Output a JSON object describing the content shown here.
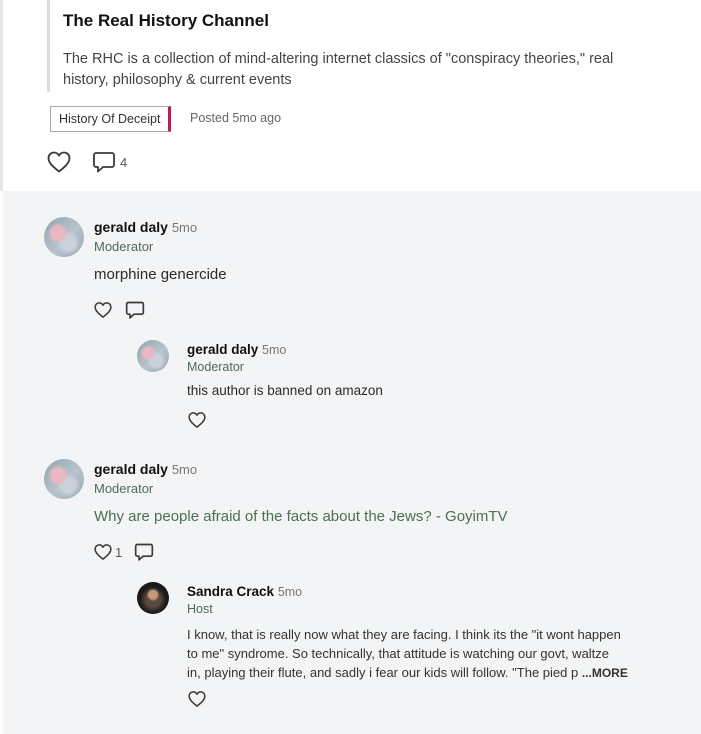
{
  "post": {
    "title": "The Real History Channel",
    "description": "The RHC is a collection of mind-altering internet classics of \"conspiracy theories,\" real history, philosophy & current events",
    "tag": "History Of Deceipt",
    "posted": "Posted 5mo ago",
    "comment_count": "4"
  },
  "comments": [
    {
      "author": "gerald daly",
      "time": "5mo",
      "role": "Moderator",
      "text": "morphine genercide",
      "likes": "",
      "replies": [
        {
          "author": "gerald daly",
          "time": "5mo",
          "role": "Moderator",
          "text": "this author is banned on amazon"
        }
      ]
    },
    {
      "author": "gerald daly",
      "time": "5mo",
      "role": "Moderator",
      "text": "Why are people afraid of the facts about the Jews? - GoyimTV",
      "likes": "1",
      "replies": [
        {
          "author": "Sandra Crack",
          "time": "5mo",
          "role": "Host",
          "text_line1": "I know, that is really now what they are facing. I think its the \"it wont happen",
          "text_line2": "to me\" syndrome. So technically, that attitude is watching our govt, waltze",
          "text_line3": "in, playing their flute, and sadly i fear our kids will follow. \"The pied p",
          "more": "...MORE"
        }
      ]
    }
  ],
  "icons": {
    "like": "heart-icon",
    "comment": "comment-bubble-icon"
  }
}
